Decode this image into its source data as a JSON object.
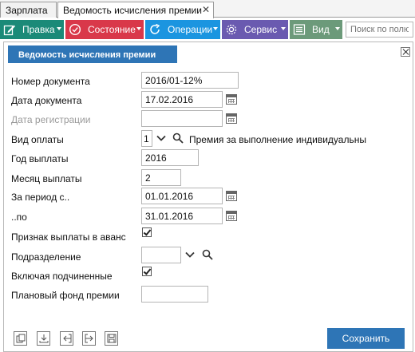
{
  "tabs": [
    {
      "label": "Зарплата"
    },
    {
      "label": "Ведомость исчисления премии"
    }
  ],
  "toolbar": {
    "buttons": [
      {
        "label": "Правка",
        "icon": "edit-icon",
        "color": "#1b8a78"
      },
      {
        "label": "Состояние",
        "icon": "state-icon",
        "color": "#d9384a"
      },
      {
        "label": "Операции",
        "icon": "refresh-icon",
        "color": "#1b95e0"
      },
      {
        "label": "Сервис",
        "icon": "gear-icon",
        "color": "#6a5ab0"
      },
      {
        "label": "Вид",
        "icon": "list-icon",
        "color": "#6c9a7a"
      }
    ],
    "search_placeholder": "Поиск по полю"
  },
  "dialog": {
    "title": "Ведомость исчисления премии",
    "fields": {
      "doc_number": {
        "label": "Номер документа",
        "value": "2016/01-12%"
      },
      "doc_date": {
        "label": "Дата документа",
        "value": "17.02.2016"
      },
      "reg_date": {
        "label": "Дата регистрации",
        "value": ""
      },
      "pay_type": {
        "label": "Вид оплаты",
        "code": "1",
        "name": "Премия за выполнение индивидуальны"
      },
      "pay_year": {
        "label": "Год выплаты",
        "value": "2016"
      },
      "pay_month": {
        "label": "Месяц выплаты",
        "value": "2"
      },
      "period_from": {
        "label": "За период с..",
        "value": "01.01.2016"
      },
      "period_to": {
        "label": "..по",
        "value": "31.01.2016"
      },
      "advance_flag": {
        "label": "Признак выплаты в аванс",
        "checked": true
      },
      "department": {
        "label": "Подразделение",
        "value": ""
      },
      "include_sub": {
        "label": "Включая подчиненные",
        "checked": true
      },
      "plan_fund": {
        "label": "Плановый фонд премии",
        "value": ""
      }
    },
    "save_label": "Сохранить"
  },
  "colors": {
    "accent": "#2e75b6"
  }
}
